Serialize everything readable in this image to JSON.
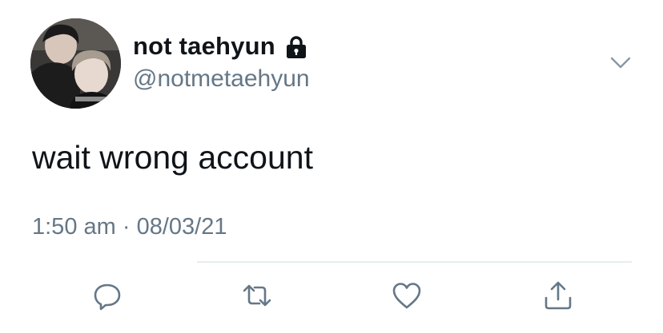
{
  "tweet": {
    "display_name": "not taehyun",
    "handle": "@notmetaehyun",
    "text": "wait wrong account",
    "time": "1:50 am",
    "separator": "·",
    "date": "08/03/21",
    "protected_icon": "lock-icon",
    "menu_icon": "chevron-down-icon"
  },
  "actions": {
    "icons": [
      "reply-icon",
      "retweet-icon",
      "like-icon",
      "share-icon"
    ]
  },
  "colors": {
    "primary_text": "#0f1419",
    "secondary_text": "#657786",
    "divider": "#e6ecf0"
  }
}
